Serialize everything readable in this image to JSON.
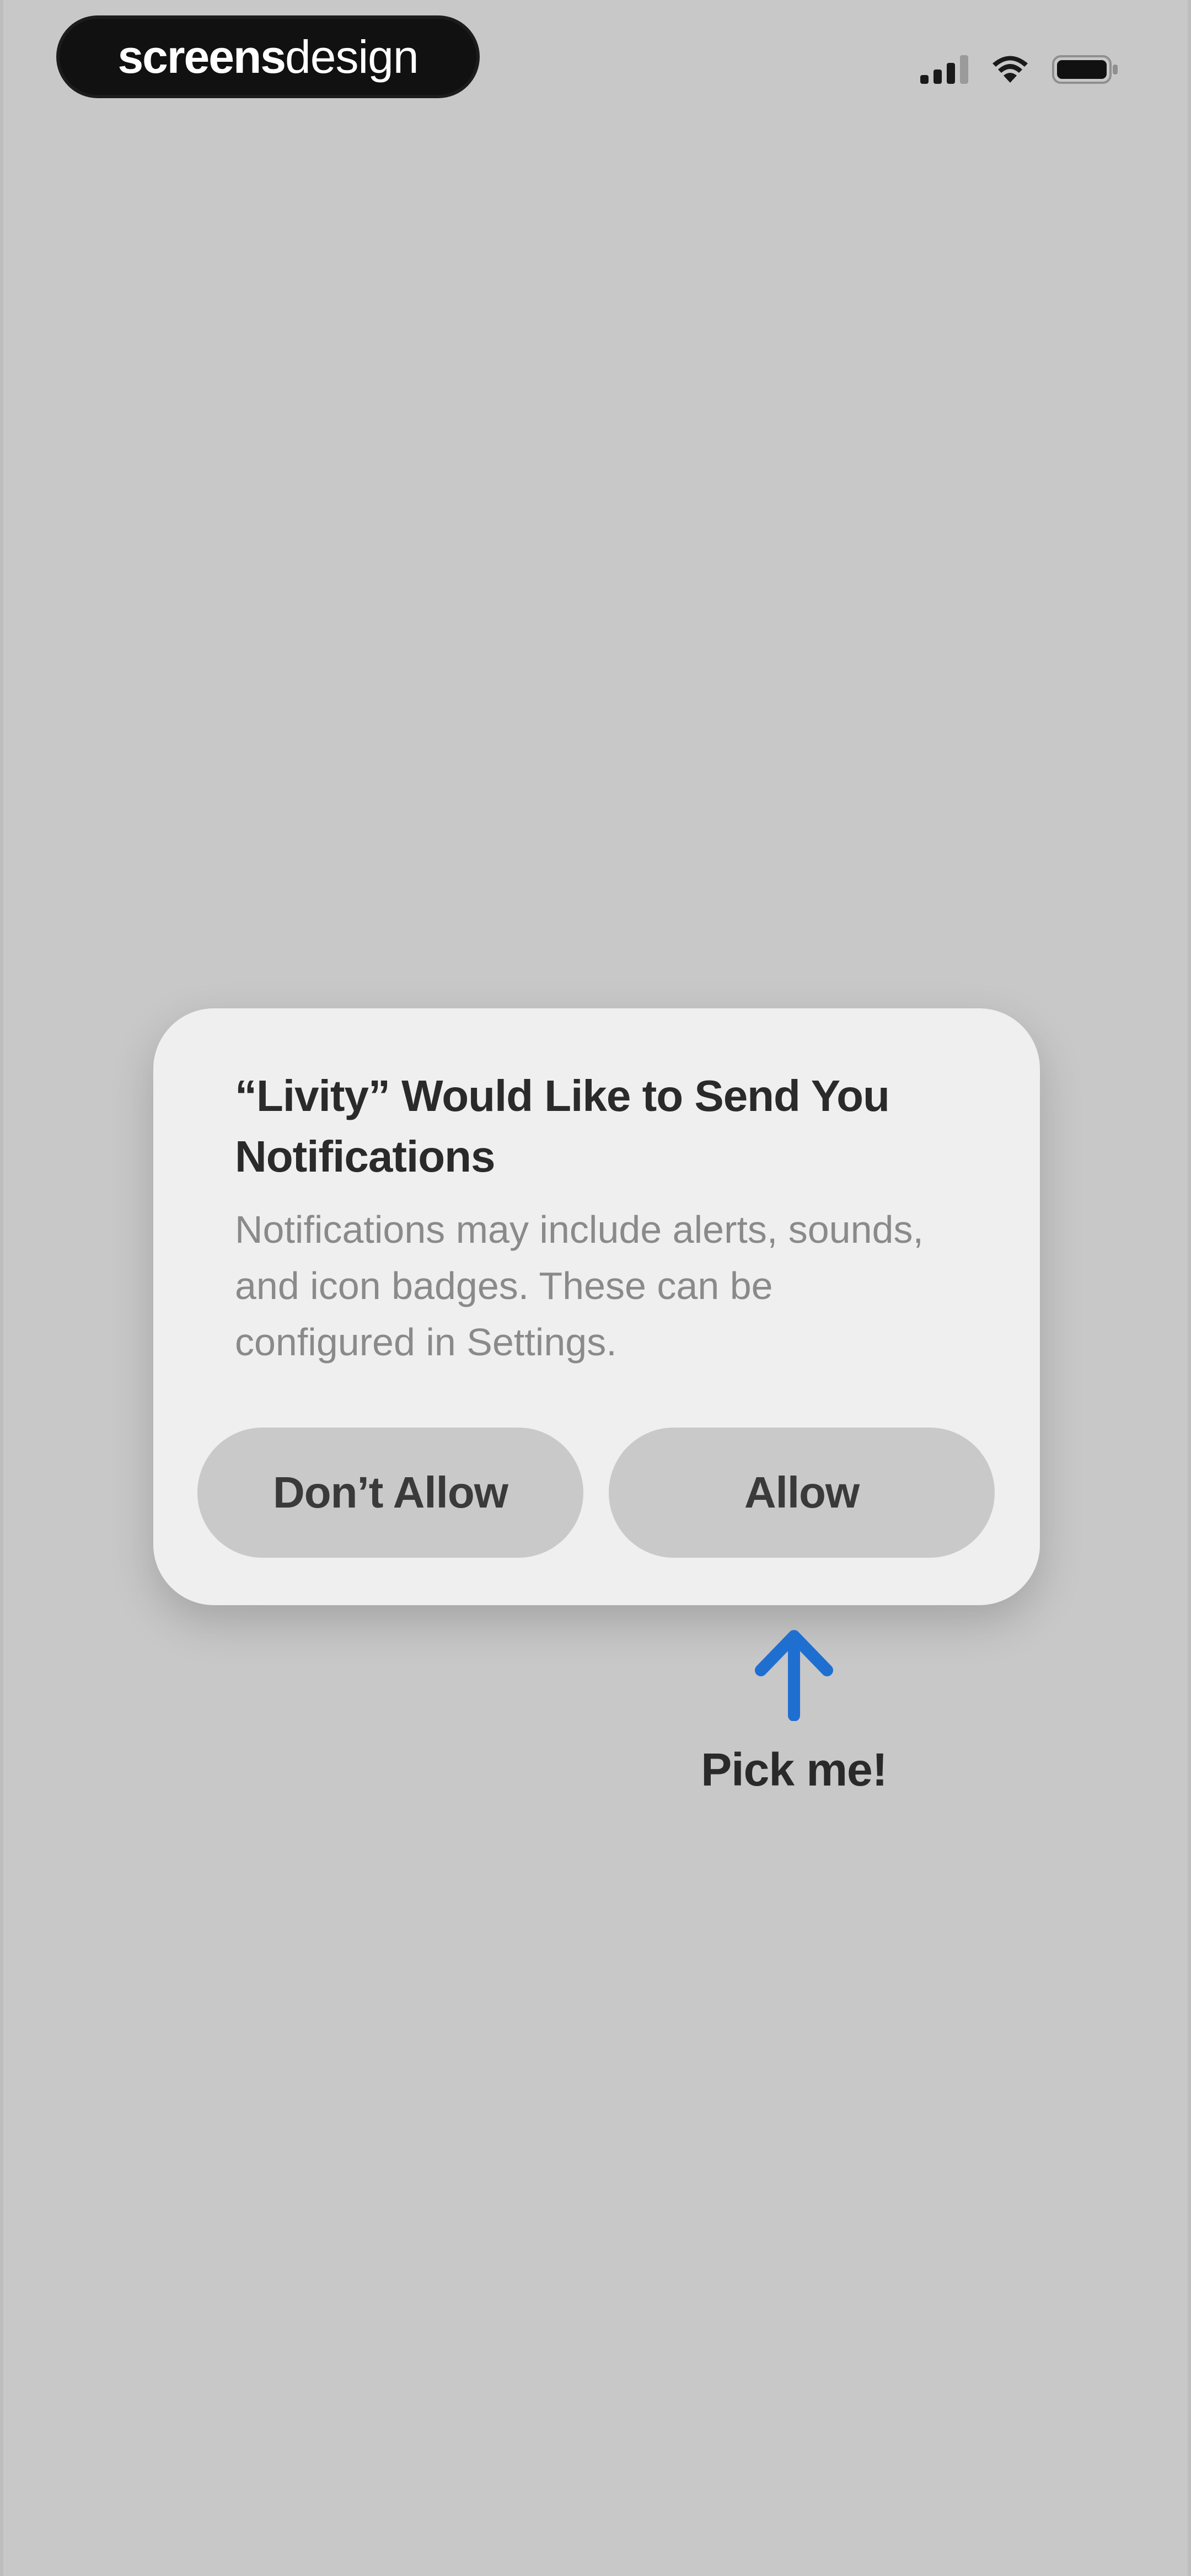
{
  "watermark": {
    "part1": "screens",
    "part2": "design"
  },
  "status_bar": {
    "icons": [
      "signal-icon",
      "wifi-icon",
      "battery-icon"
    ]
  },
  "alert": {
    "title": "“Livity” Would Like to Send You Notifications",
    "message": "Notifications may include alerts, sounds, and icon badges. These can be configured in Settings.",
    "deny_label": "Don’t Allow",
    "allow_label": "Allow"
  },
  "hint": {
    "icon": "arrow-up-icon",
    "label": "Pick me!",
    "color": "#1f6fd1"
  },
  "colors": {
    "background": "#c8c8c8",
    "alert_bg": "#efefef",
    "button_bg": "#c9c9c9",
    "arrow": "#1f6fd1"
  }
}
